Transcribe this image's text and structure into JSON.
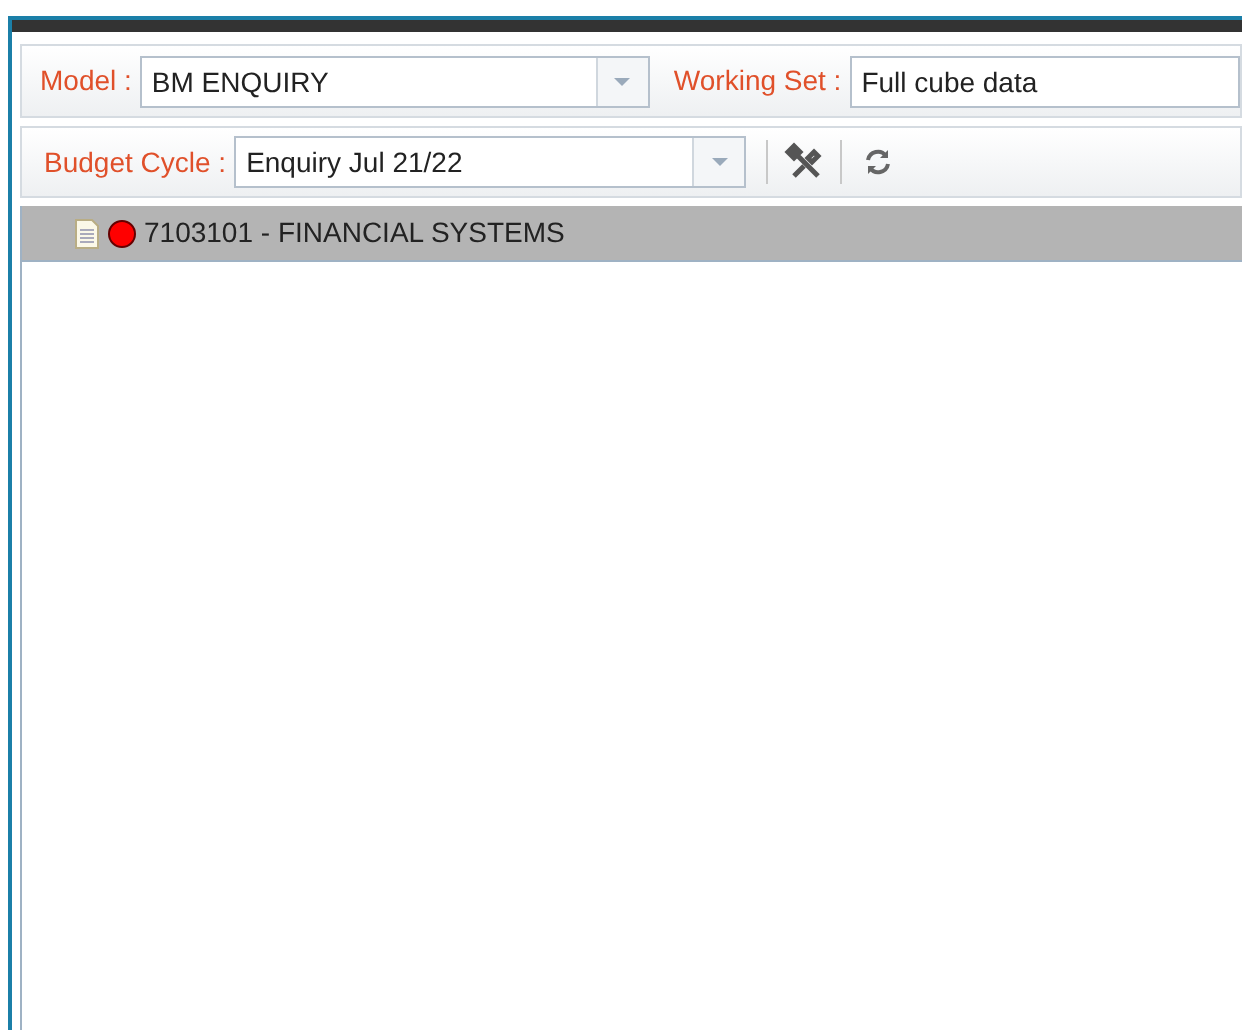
{
  "model_bar": {
    "model": {
      "label": "Model :",
      "value": "BM ENQUIRY"
    },
    "working_set": {
      "label": "Working Set :",
      "value": "Full cube data"
    }
  },
  "cycle_bar": {
    "label": "Budget Cycle :",
    "value": "Enquiry Jul 21/22"
  },
  "tree": {
    "items": [
      {
        "label": "7103101 - FINANCIAL SYSTEMS",
        "selected": true,
        "color": "#ff0000"
      }
    ]
  }
}
